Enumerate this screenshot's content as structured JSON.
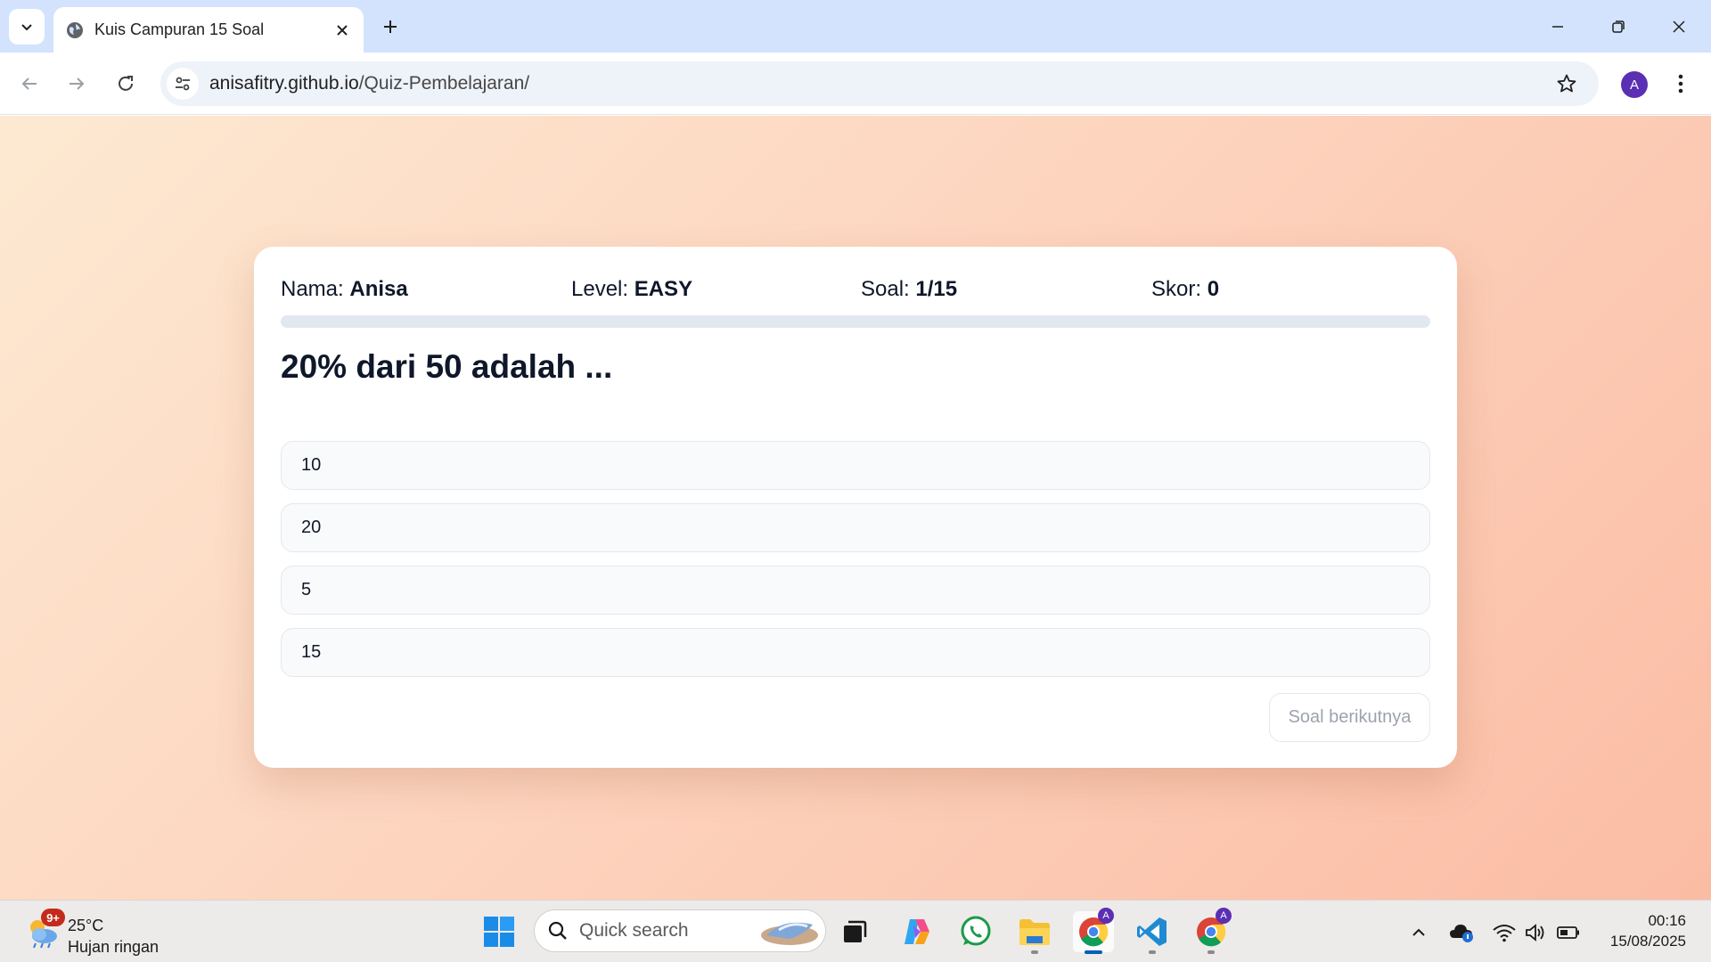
{
  "browser": {
    "tab_title": "Kuis Campuran 15 Soal",
    "url_host": "anisafitry.github.io",
    "url_path": "/Quiz-Pembelajaran/",
    "profile_initial": "A"
  },
  "quiz": {
    "name_label": "Nama:",
    "name_value": "Anisa",
    "level_label": "Level:",
    "level_value": "EASY",
    "question_count_label": "Soal:",
    "question_count_value": "1/15",
    "score_label": "Skor:",
    "score_value": "0",
    "progress_fraction": 0,
    "question": "20% dari 50 adalah ...",
    "options": [
      "10",
      "20",
      "5",
      "15"
    ],
    "next_button": "Soal berikutnya"
  },
  "taskbar": {
    "weather_badge": "9+",
    "weather_temp": "25°C",
    "weather_desc": "Hujan ringan",
    "search_placeholder": "Quick search",
    "time": "00:16",
    "date": "15/08/2025",
    "chrome_profile_badge": "A",
    "chrome2_profile_badge": "A"
  },
  "colors": {
    "tabstrip": "#d3e3fd",
    "page_gradient_start": "#fde9d2",
    "page_gradient_end": "#fbbca4",
    "profile": "#5b2fb3"
  }
}
